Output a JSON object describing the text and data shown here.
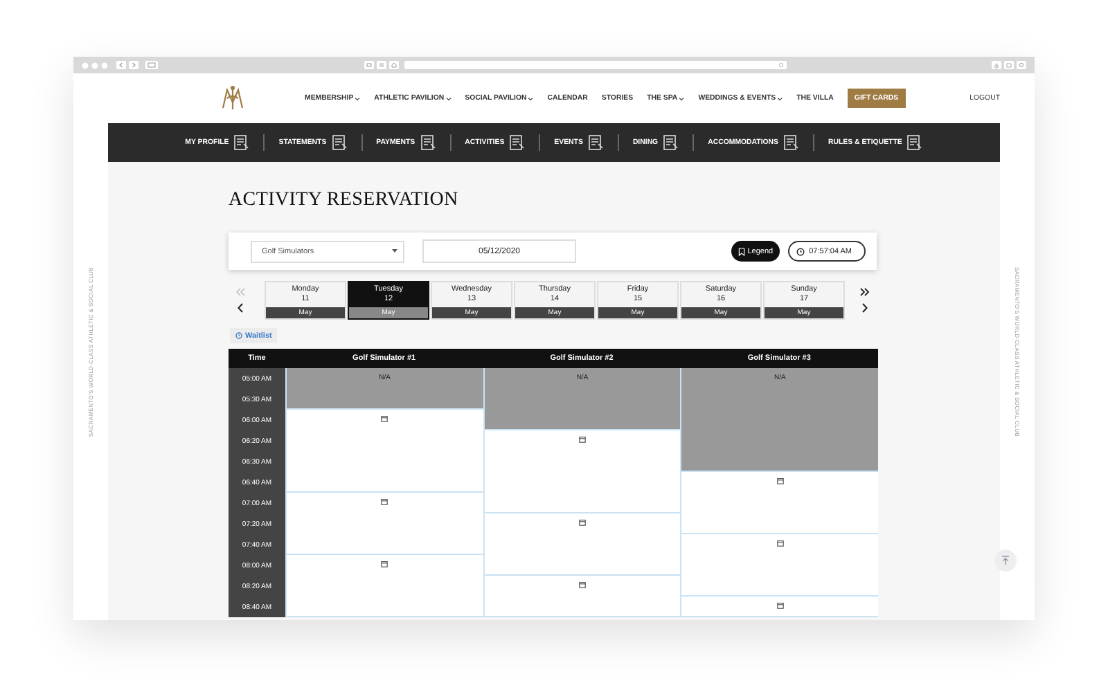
{
  "header": {
    "nav": [
      {
        "label": "MEMBERSHIP",
        "has_menu": true,
        "highlighted": false
      },
      {
        "label": "ATHLETIC PAVILION",
        "has_menu": true,
        "highlighted": false
      },
      {
        "label": "SOCIAL PAVILION",
        "has_menu": true,
        "highlighted": false
      },
      {
        "label": "CALENDAR",
        "has_menu": false,
        "highlighted": false
      },
      {
        "label": "STORIES",
        "has_menu": false,
        "highlighted": false
      },
      {
        "label": "THE SPA",
        "has_menu": true,
        "highlighted": false
      },
      {
        "label": "WEDDINGS & EVENTS",
        "has_menu": true,
        "highlighted": false
      },
      {
        "label": "THE VILLA",
        "has_menu": false,
        "highlighted": false
      },
      {
        "label": "GIFT CARDS",
        "has_menu": false,
        "highlighted": true
      }
    ],
    "logout": "LOGOUT"
  },
  "member_bar": [
    {
      "label": "MY PROFILE",
      "selected": false
    },
    {
      "label": "STATEMENTS",
      "selected": false
    },
    {
      "label": "PAYMENTS",
      "selected": false
    },
    {
      "label": "ACTIVITIES",
      "selected": false
    },
    {
      "label": "EVENTS",
      "selected": false
    },
    {
      "label": "DINING",
      "selected": false
    },
    {
      "label": "ACCOMMODATIONS",
      "selected": false
    },
    {
      "label": "RULES & ETIQUETTE",
      "selected": false
    }
  ],
  "side_text_left": "SACRAMENTO'S WORLD-CLASS ATHLETIC & SOCIAL CLUB",
  "side_text_right": "SACRAMENTO'S WORLD-CLASS ATHLETIC & SOCIAL CLUB",
  "title": "ACTIVITY RESERVATION",
  "controls": {
    "activity": "Golf Simulators",
    "date": "05/12/2020",
    "legend": "Legend",
    "time": "07:57:04 AM"
  },
  "week": [
    {
      "day": "Monday",
      "date": "11",
      "month": "May",
      "selected": false
    },
    {
      "day": "Tuesday",
      "date": "12",
      "month": "May",
      "selected": true
    },
    {
      "day": "Wednesday",
      "date": "13",
      "month": "May",
      "selected": false
    },
    {
      "day": "Thursday",
      "date": "14",
      "month": "May",
      "selected": false
    },
    {
      "day": "Friday",
      "date": "15",
      "month": "May",
      "selected": false
    },
    {
      "day": "Saturday",
      "date": "16",
      "month": "May",
      "selected": false
    },
    {
      "day": "Sunday",
      "date": "17",
      "month": "May",
      "selected": false
    }
  ],
  "waitlist": "Waitlist",
  "table": {
    "time_header": "Time",
    "times": [
      "05:00 AM",
      "05:30 AM",
      "06:00 AM",
      "06:20 AM",
      "06:30 AM",
      "06:40 AM",
      "07:00 AM",
      "07:20 AM",
      "07:40 AM",
      "08:00 AM",
      "08:20 AM",
      "08:40 AM"
    ],
    "columns": [
      {
        "name": "Golf Simulator #1",
        "cells": [
          {
            "kind": "unavailable",
            "text": "N/A"
          },
          {
            "kind": "open"
          },
          {
            "kind": "open"
          },
          {
            "kind": "open"
          }
        ]
      },
      {
        "name": "Golf Simulator #2",
        "cells": [
          {
            "kind": "unavailable",
            "text": "N/A"
          },
          {
            "kind": "open"
          },
          {
            "kind": "open"
          },
          {
            "kind": "open"
          }
        ]
      },
      {
        "name": "Golf Simulator #3",
        "cells": [
          {
            "kind": "unavailable",
            "text": "N/A"
          },
          {
            "kind": "open"
          },
          {
            "kind": "open"
          },
          {
            "kind": "open"
          }
        ]
      }
    ]
  }
}
